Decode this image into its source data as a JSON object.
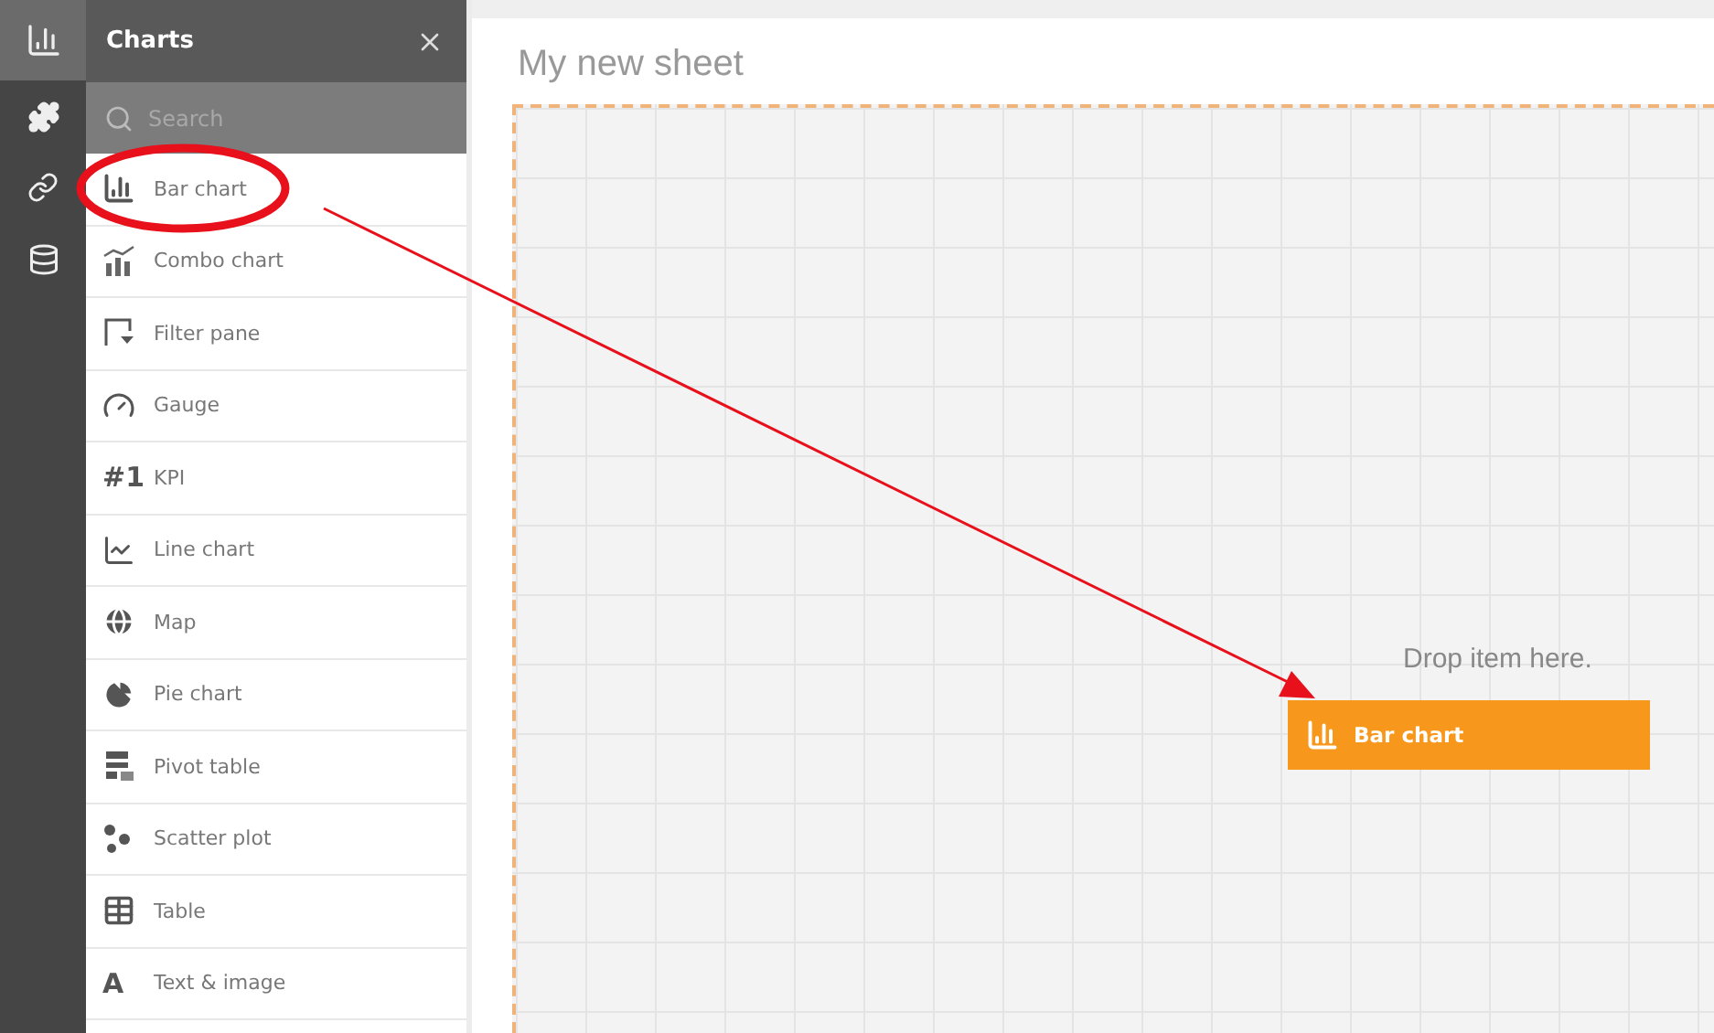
{
  "rail": [
    {
      "kind": "charts",
      "selected": true
    },
    {
      "kind": "extensions",
      "selected": false
    },
    {
      "kind": "links",
      "selected": false
    },
    {
      "kind": "data",
      "selected": false
    }
  ],
  "panel": {
    "title": "Charts",
    "search": {
      "placeholder": "Search"
    },
    "items": [
      {
        "kind": "bar",
        "label": "Bar chart"
      },
      {
        "kind": "combo",
        "label": "Combo chart"
      },
      {
        "kind": "filter",
        "label": "Filter pane"
      },
      {
        "kind": "gauge",
        "label": "Gauge"
      },
      {
        "kind": "kpi",
        "glyph": "#1",
        "label": "KPI"
      },
      {
        "kind": "line",
        "label": "Line chart"
      },
      {
        "kind": "map",
        "label": "Map"
      },
      {
        "kind": "pie",
        "label": "Pie chart"
      },
      {
        "kind": "pivot",
        "label": "Pivot table"
      },
      {
        "kind": "scatter",
        "label": "Scatter plot"
      },
      {
        "kind": "table",
        "label": "Table"
      },
      {
        "kind": "text",
        "glyph": "A",
        "label": "Text & image"
      }
    ]
  },
  "sheet": {
    "title": "My new sheet",
    "drop_hint": "Drop item here.",
    "dragged_item": {
      "kind": "bar",
      "label": "Bar chart"
    }
  }
}
